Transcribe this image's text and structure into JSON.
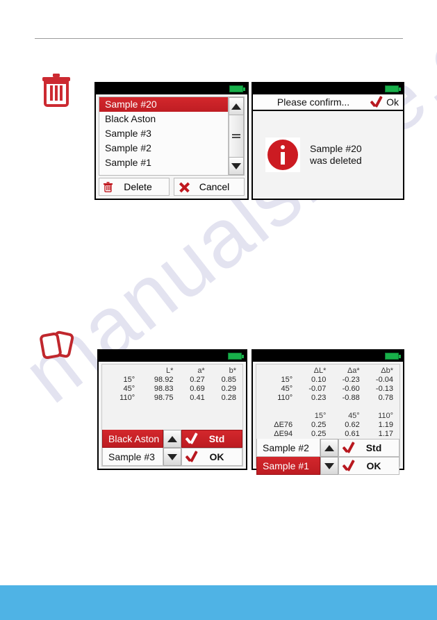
{
  "page": {
    "watermark": "manualshive.com",
    "footer_color": "#4fb3e5",
    "accent_red": "#cc2026",
    "battery_green": "#18b04a"
  },
  "margin_icons": [
    {
      "name": "trash-icon",
      "label": "delete"
    },
    {
      "name": "cards-icon",
      "label": "samples"
    }
  ],
  "panels": {
    "sample_list": {
      "items": [
        {
          "label": "Sample #20",
          "selected": true
        },
        {
          "label": "Black Aston",
          "selected": false
        },
        {
          "label": "Sample #3",
          "selected": false
        },
        {
          "label": "Sample #2",
          "selected": false
        },
        {
          "label": "Sample #1",
          "selected": false
        }
      ],
      "buttons": {
        "delete": "Delete",
        "cancel": "Cancel"
      }
    },
    "confirm": {
      "title": "Please confirm...",
      "ok": "Ok",
      "message_line1": "Sample #20",
      "message_line2": "was deleted"
    },
    "measure_std": {
      "columns": [
        "",
        "L*",
        "a*",
        "b*"
      ],
      "rows": [
        {
          "angle": "15°",
          "values": [
            "98.92",
            "0.27",
            "0.85"
          ]
        },
        {
          "angle": "45°",
          "values": [
            "98.83",
            "0.69",
            "0.29"
          ]
        },
        {
          "angle": "110°",
          "values": [
            "98.75",
            "0.41",
            "0.28"
          ]
        }
      ],
      "names": [
        {
          "label": "Black Aston",
          "selected": true
        },
        {
          "label": "Sample #3",
          "selected": false
        }
      ],
      "actions": {
        "std": "Std",
        "ok": "OK",
        "std_filled": true,
        "ok_filled": false
      }
    },
    "measure_diff": {
      "columns": [
        "",
        "ΔL*",
        "Δa*",
        "Δb*"
      ],
      "rows": [
        {
          "angle": "15°",
          "values": [
            "0.10",
            "-0.23",
            "-0.04"
          ]
        },
        {
          "angle": "45°",
          "values": [
            "-0.07",
            "-0.60",
            "-0.13"
          ]
        },
        {
          "angle": "110°",
          "values": [
            "0.23",
            "-0.88",
            "0.78"
          ]
        }
      ],
      "de_columns": [
        "",
        "15°",
        "45°",
        "110°"
      ],
      "de_rows": [
        {
          "label": "ΔE76",
          "values": [
            "0.25",
            "0.62",
            "1.19"
          ]
        },
        {
          "label": "ΔE94",
          "values": [
            "0.25",
            "0.61",
            "1.17"
          ]
        }
      ],
      "names": [
        {
          "label": "Sample #2",
          "selected": false
        },
        {
          "label": "Sample #1",
          "selected": true
        }
      ],
      "actions": {
        "std": "Std",
        "ok": "OK",
        "std_filled": false,
        "ok_filled": false
      }
    }
  }
}
